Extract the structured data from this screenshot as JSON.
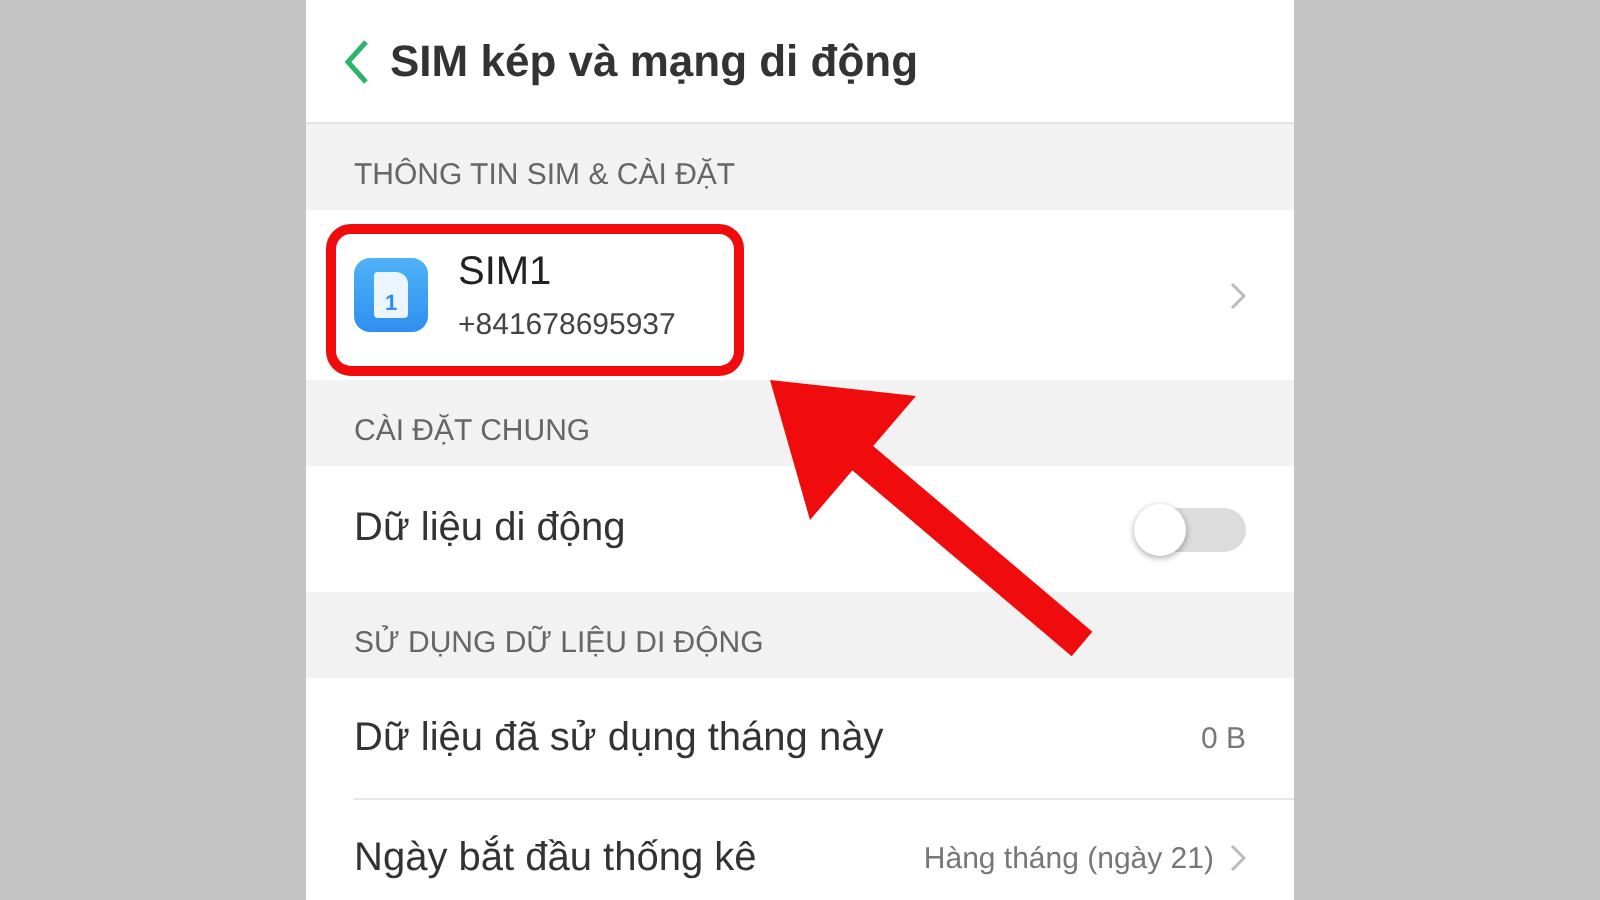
{
  "header": {
    "title": "SIM kép và mạng di động"
  },
  "sections": [
    {
      "title": "THÔNG TIN SIM & CÀI ĐẶT",
      "rows": [
        {
          "kind": "sim",
          "title": "SIM1",
          "subtitle": "+841678695937",
          "icon_label": "1",
          "chevron": true
        }
      ]
    },
    {
      "title": "CÀI ĐẶT CHUNG",
      "rows": [
        {
          "kind": "toggle",
          "title": "Dữ liệu di động",
          "on": false
        }
      ]
    },
    {
      "title": "SỬ DỤNG DỮ LIỆU DI ĐỘNG",
      "rows": [
        {
          "kind": "value",
          "title": "Dữ liệu đã sử dụng tháng này",
          "value": "0 B",
          "chevron": false
        },
        {
          "kind": "value",
          "title": "Ngày bắt đầu thống kê",
          "value": "Hàng tháng (ngày 21)",
          "chevron": true
        }
      ]
    }
  ]
}
